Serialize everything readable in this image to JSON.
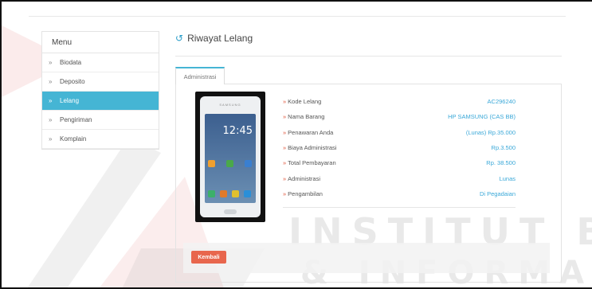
{
  "colors": {
    "accent": "#45b5d4",
    "value_text": "#3aa8d8",
    "button": "#e8664d",
    "label_marker": "#e0553a"
  },
  "sidebar": {
    "heading": "Menu",
    "items": [
      {
        "label": "Biodata",
        "active": false
      },
      {
        "label": "Deposito",
        "active": false
      },
      {
        "label": "Lelang",
        "active": true
      },
      {
        "label": "Pengiriman",
        "active": false
      },
      {
        "label": "Komplain",
        "active": false
      }
    ]
  },
  "main": {
    "title": "Riwayat Lelang",
    "title_icon": "history-icon",
    "tab_label": "Administrasi",
    "product_image": "samsung-phone-image",
    "phone_brand": "SAMSUNG",
    "phone_clock": "12:45",
    "details": [
      {
        "label": "Kode Lelang",
        "value": "AC296240"
      },
      {
        "label": "Nama Barang",
        "value": "HP SAMSUNG (CAS BB)"
      },
      {
        "label": "Penawaran Anda",
        "value": "(Lunas) Rp.35.000"
      },
      {
        "label": "Biaya Administrasi",
        "value": "Rp.3.500"
      },
      {
        "label": "Total Pembayaran",
        "value": "Rp. 38.500"
      },
      {
        "label": "Administrasi",
        "value": "Lunas"
      },
      {
        "label": "Pengambilan",
        "value": "Di Pegadaian"
      }
    ],
    "back_button": "Kembali"
  },
  "watermark": {
    "line1": "INSTITUT BI",
    "line2": "& INFORMA"
  }
}
